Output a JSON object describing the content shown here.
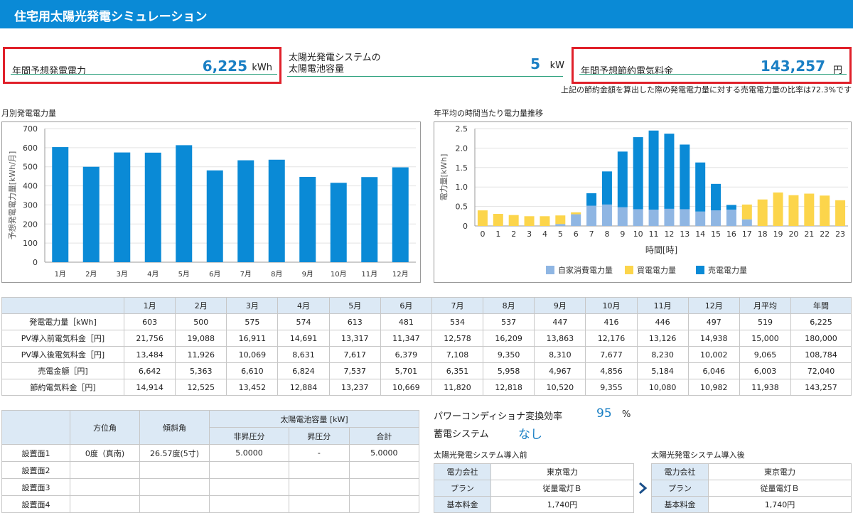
{
  "header": {
    "title": "住宅用太陽光発電シミュレーション"
  },
  "summary": {
    "annual_power": {
      "label": "年間予想発電電力",
      "value": "6,225",
      "unit": "kWh"
    },
    "capacity": {
      "label_line1": "太陽光発電システムの",
      "label_line2": "太陽電池容量",
      "value": "5",
      "unit": "kW"
    },
    "savings": {
      "label": "年間予想節約電気料金",
      "value": "143,257",
      "unit": "円"
    }
  },
  "note": "上記の節約金額を算出した際の発電電力量に対する売電電力量の比率は72.3%です",
  "monthly_chart": {
    "title": "月別発電電力量"
  },
  "hourly_chart": {
    "title": "年平均の時間当たり電力量推移"
  },
  "chart_data": [
    {
      "type": "bar",
      "ylabel": "予想発電電力量[kWh/月]",
      "ylim": [
        0,
        700
      ],
      "yticks": [
        0,
        100,
        200,
        300,
        400,
        500,
        600,
        700
      ],
      "grid": true,
      "categories": [
        "1月",
        "2月",
        "3月",
        "4月",
        "5月",
        "6月",
        "7月",
        "8月",
        "9月",
        "10月",
        "11月",
        "12月"
      ],
      "values": [
        603,
        500,
        575,
        574,
        613,
        481,
        534,
        537,
        447,
        416,
        446,
        497
      ],
      "color": "#0a8ad6"
    },
    {
      "type": "bar",
      "stacked": true,
      "xlabel": "時間[時]",
      "ylabel": "電力量[kWh]",
      "ylim": [
        0,
        2.5
      ],
      "yticks": [
        "0",
        "0.5",
        "1.0",
        "1.5",
        "2.0",
        "2.5"
      ],
      "grid": true,
      "categories": [
        "0",
        "1",
        "2",
        "3",
        "4",
        "5",
        "6",
        "7",
        "8",
        "9",
        "10",
        "11",
        "12",
        "13",
        "14",
        "15",
        "16",
        "17",
        "18",
        "19",
        "20",
        "21",
        "22",
        "23"
      ],
      "legend_position": "bottom",
      "series": [
        {
          "name": "自家消費電力量",
          "color": "#8fb6e3",
          "values": [
            0,
            0,
            0,
            0,
            0,
            0.05,
            0.3,
            0.52,
            0.55,
            0.48,
            0.43,
            0.42,
            0.44,
            0.43,
            0.37,
            0.4,
            0.42,
            0.17,
            0,
            0,
            0,
            0,
            0,
            0
          ]
        },
        {
          "name": "買電電力量",
          "color": "#fcd54b",
          "values": [
            0.4,
            0.31,
            0.28,
            0.25,
            0.25,
            0.22,
            0.05,
            0,
            0,
            0,
            0,
            0,
            0,
            0,
            0,
            0,
            0,
            0.38,
            0.68,
            0.86,
            0.79,
            0.83,
            0.78,
            0.66
          ]
        },
        {
          "name": "売電電力量",
          "color": "#0a8ad6",
          "values": [
            0,
            0,
            0,
            0,
            0,
            0,
            0,
            0.32,
            0.85,
            1.43,
            1.85,
            2.03,
            1.93,
            1.66,
            1.26,
            0.68,
            0.12,
            0,
            0,
            0,
            0,
            0,
            0,
            0
          ]
        }
      ]
    }
  ],
  "monthly_table": {
    "headers": [
      "",
      "1月",
      "2月",
      "3月",
      "4月",
      "5月",
      "6月",
      "7月",
      "8月",
      "9月",
      "10月",
      "11月",
      "12月",
      "月平均",
      "年間"
    ],
    "rows": [
      [
        "発電電力量［kWh]",
        "603",
        "500",
        "575",
        "574",
        "613",
        "481",
        "534",
        "537",
        "447",
        "416",
        "446",
        "497",
        "519",
        "6,225"
      ],
      [
        "PV導入前電気料金［円]",
        "21,756",
        "19,088",
        "16,911",
        "14,691",
        "13,317",
        "11,347",
        "12,578",
        "16,209",
        "13,863",
        "12,176",
        "13,126",
        "14,938",
        "15,000",
        "180,000"
      ],
      [
        "PV導入後電気料金［円]",
        "13,484",
        "11,926",
        "10,069",
        "8,631",
        "7,617",
        "6,379",
        "7,108",
        "9,350",
        "8,310",
        "7,677",
        "8,230",
        "10,002",
        "9,065",
        "108,784"
      ],
      [
        "売電金額［円]",
        "6,642",
        "5,363",
        "6,610",
        "6,824",
        "7,537",
        "5,701",
        "6,351",
        "5,958",
        "4,967",
        "4,856",
        "5,184",
        "6,046",
        "6,003",
        "72,040"
      ],
      [
        "節約電気料金［円]",
        "14,914",
        "12,525",
        "13,452",
        "12,884",
        "13,237",
        "10,669",
        "11,820",
        "12,818",
        "10,520",
        "9,355",
        "10,080",
        "10,982",
        "11,938",
        "143,257"
      ]
    ]
  },
  "panel_table": {
    "h_azimuth": "方位角",
    "h_tilt": "傾斜角",
    "h_capacity": "太陽電池容量 [kW]",
    "h_nonboost": "非昇圧分",
    "h_boost": "昇圧分",
    "h_total": "合計",
    "rows": [
      [
        "設置面1",
        "0度（真南)",
        "26.57度(5寸)",
        "5.0000",
        "-",
        "5.0000"
      ],
      [
        "設置面2",
        "",
        "",
        "",
        "",
        ""
      ],
      [
        "設置面3",
        "",
        "",
        "",
        "",
        ""
      ],
      [
        "設置面4",
        "",
        "",
        "",
        "",
        ""
      ]
    ]
  },
  "settings": {
    "pcs_label": "パワーコンディショナ変換効率",
    "pcs_value": "95",
    "pcs_unit": "%",
    "storage_label": "蓄電システム",
    "storage_value": "なし"
  },
  "before": {
    "title": "太陽光発電システム導入前",
    "rows": [
      [
        "電力会社",
        "東京電力"
      ],
      [
        "プラン",
        "従量電灯Ｂ"
      ],
      [
        "基本料金",
        "1,740円"
      ]
    ]
  },
  "after": {
    "title": "太陽光発電システム導入後",
    "rows": [
      [
        "電力会社",
        "東京電力"
      ],
      [
        "プラン",
        "従量電灯Ｂ"
      ],
      [
        "基本料金",
        "1,740円"
      ]
    ]
  },
  "icons": {
    "arrow": "chevron-right-icon"
  },
  "colors": {
    "header": "#0a8ad6",
    "accent_value": "#1a7fc4",
    "highlight_box": "#e0202a",
    "table_head": "#dce9f5"
  }
}
